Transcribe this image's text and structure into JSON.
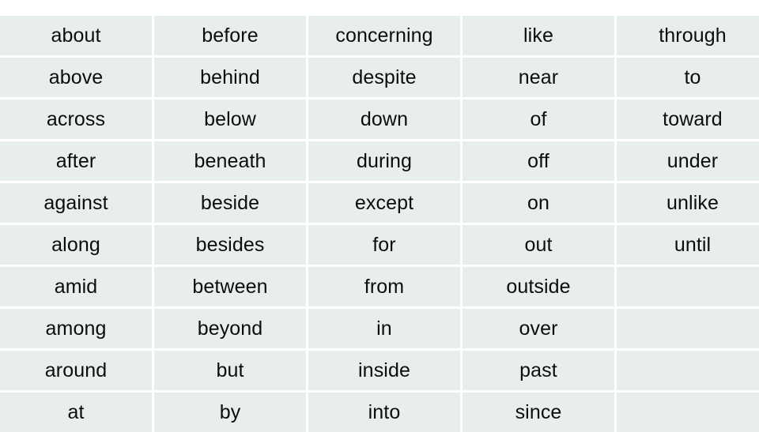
{
  "document": {
    "title": "Prepositions Table",
    "background_color": "#FFFFFF",
    "cell_background_color": "#E7EEEC",
    "gridline_color": "#FFFFFF",
    "text_color": "#0D0D0D"
  },
  "table": {
    "column_count": 5,
    "row_count": 10,
    "columns": [
      {
        "index": 0,
        "words": [
          "about",
          "above",
          "across",
          "after",
          "against",
          "along",
          "amid",
          "among",
          "around",
          "at"
        ]
      },
      {
        "index": 1,
        "words": [
          "before",
          "behind",
          "below",
          "beneath",
          "beside",
          "besides",
          "between",
          "beyond",
          "but",
          "by"
        ]
      },
      {
        "index": 2,
        "words": [
          "concerning",
          "despite",
          "down",
          "during",
          "except",
          "for",
          "from",
          "in",
          "inside",
          "into"
        ]
      },
      {
        "index": 3,
        "words": [
          "like",
          "near",
          "of",
          "off",
          "on",
          "out",
          "outside",
          "over",
          "past",
          "since"
        ]
      },
      {
        "index": 4,
        "words": [
          "through",
          "to",
          "toward",
          "under",
          "unlike",
          "until",
          "",
          "",
          "",
          ""
        ]
      }
    ],
    "rows": [
      [
        "about",
        "before",
        "concerning",
        "like",
        "through"
      ],
      [
        "above",
        "behind",
        "despite",
        "near",
        "to"
      ],
      [
        "across",
        "below",
        "down",
        "of",
        "toward"
      ],
      [
        "after",
        "beneath",
        "during",
        "off",
        "under"
      ],
      [
        "against",
        "beside",
        "except",
        "on",
        "unlike"
      ],
      [
        "along",
        "besides",
        "for",
        "out",
        "until"
      ],
      [
        "amid",
        "between",
        "from",
        "outside",
        ""
      ],
      [
        "among",
        "beyond",
        "in",
        "over",
        ""
      ],
      [
        "around",
        "but",
        "inside",
        "past",
        ""
      ],
      [
        "at",
        "by",
        "into",
        "since",
        ""
      ]
    ]
  }
}
